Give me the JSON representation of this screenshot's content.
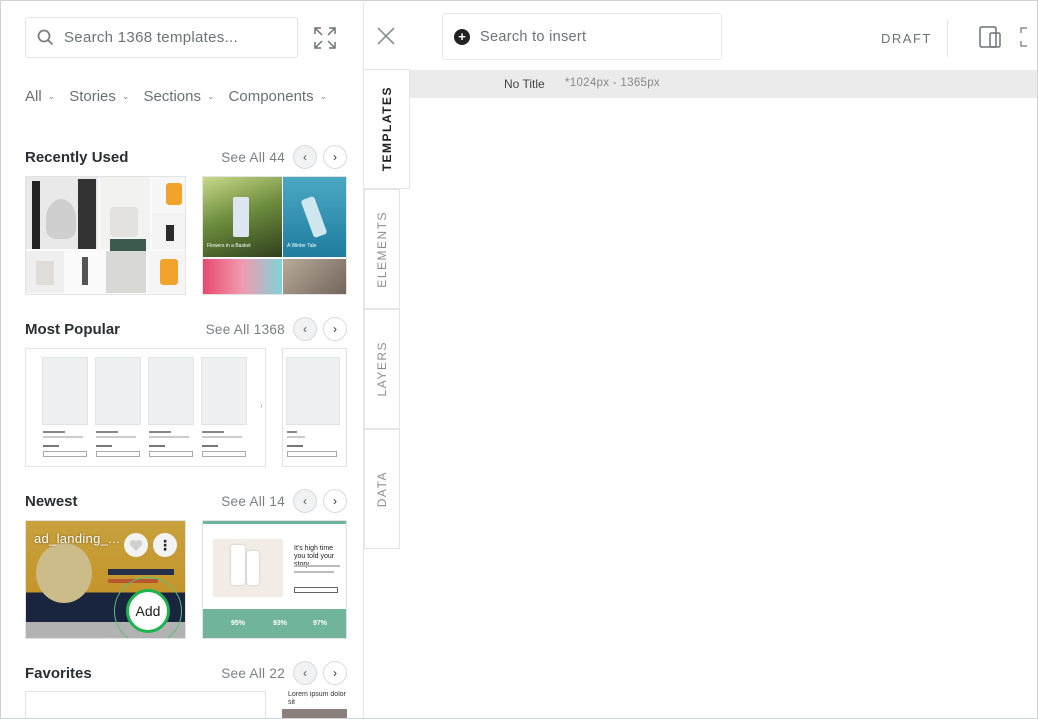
{
  "panel": {
    "search_placeholder": "Search 1368 templates...",
    "filters": [
      {
        "label": "All"
      },
      {
        "label": "Stories"
      },
      {
        "label": "Sections"
      },
      {
        "label": "Components"
      }
    ],
    "sections": {
      "recently_used": {
        "title": "Recently Used",
        "see_all": "See All 44"
      },
      "most_popular": {
        "title": "Most Popular",
        "see_all": "See All 1368"
      },
      "newest": {
        "title": "Newest",
        "see_all": "See All 14"
      },
      "favorites": {
        "title": "Favorites",
        "see_all": "See All 22"
      }
    },
    "newest_card": {
      "name": "ad_landing_...",
      "add_label": "Add"
    },
    "thumb_texts": {
      "flowers": "Flowers in a Basket",
      "winter": "A Winter Tale",
      "story_heading": "It's high time you told your story",
      "stat1": "95%",
      "stat2": "93%",
      "stat3": "97%",
      "fav_text": "Lorem ipsum dolor sit"
    }
  },
  "tabs": [
    {
      "label": "TEMPLATES"
    },
    {
      "label": "ELEMENTS"
    },
    {
      "label": "LAYERS"
    },
    {
      "label": "DATA"
    }
  ],
  "topbar": {
    "search_insert": "Search to insert",
    "draft": "DRAFT"
  },
  "canvas": {
    "title": "No Title",
    "size": "*1024px - 1365px"
  },
  "colors": {
    "accent_green": "#1eb34e",
    "teal": "#6fb49b",
    "yellow": "#f5b82e",
    "navy": "#1f2d4e"
  }
}
